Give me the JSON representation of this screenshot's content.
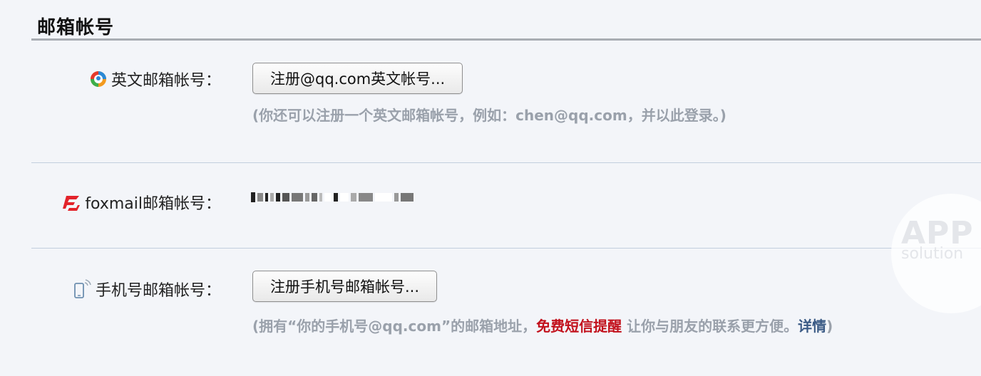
{
  "section": {
    "title": "邮箱帐号"
  },
  "rows": [
    {
      "icon": "qq-logo-icon",
      "label": "英文邮箱帐号：",
      "button_label": "注册@qq.com英文帐号...",
      "hint": "(你还可以注册一个英文邮箱帐号，例如：chen@qq.com，并以此登录。)"
    },
    {
      "icon": "foxmail-logo-icon",
      "label": "foxmail邮箱帐号："
    },
    {
      "icon": "mobile-phone-icon",
      "label": "手机号邮箱帐号：",
      "button_label": "注册手机号邮箱帐号...",
      "hint_prefix": "(拥有“你的手机号@qq.com”的邮箱地址，",
      "hint_red": "免费短信提醒",
      "hint_middle": " 让你与朋友的联系更方便。",
      "hint_link": "详情",
      "hint_suffix": ")"
    }
  ],
  "watermark": {
    "line1": "APP",
    "line2": "solution"
  },
  "colors": {
    "red": "#c2111c",
    "link": "#3a5a85",
    "hint": "#9aa1ab",
    "divider": "#c2cede"
  }
}
